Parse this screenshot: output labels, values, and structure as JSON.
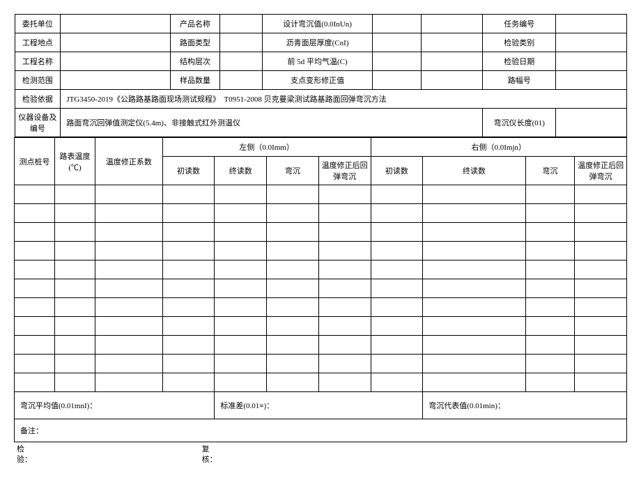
{
  "header": {
    "r1": {
      "c1_lbl": "委托单位",
      "c1_val": "",
      "c2_lbl": "产品名称",
      "c2_val": "",
      "c3_lbl": "设计弯沉值(0.0InUn)",
      "c3_val": "",
      "c4_lbl": "任务编号",
      "c4_val": ""
    },
    "r2": {
      "c1_lbl": "工程地点",
      "c1_val": "",
      "c2_lbl": "路面类型",
      "c2_val": "",
      "c3_lbl": "沥青面层厚度(CnI)",
      "c3_val": "",
      "c4_lbl": "检验类别",
      "c4_val": ""
    },
    "r3": {
      "c1_lbl": "工程名称",
      "c1_val": "",
      "c2_lbl": "结构层次",
      "c2_val": "",
      "c3_lbl": "前 5d 平均气温(C)",
      "c3_val": "",
      "c4_lbl": "检验日期",
      "c4_val": ""
    },
    "r4": {
      "c1_lbl": "检测范围",
      "c1_val": "",
      "c2_lbl": "样品数量",
      "c2_val": "",
      "c3_lbl": "支点变形修正值",
      "c3_val": "",
      "c4_lbl": "路幅号",
      "c4_val": ""
    },
    "r5": {
      "lbl": "检验依据",
      "val": "JTG3450-2019《公路路基路面现场测试规程》　T0951-2008 贝克曼梁测试路基路面回弹弯沉方法"
    },
    "r6": {
      "c1_lbl": "仪器设备及编号",
      "c1_val": "路面弯沉回弹值测定仪(5.4m)、非接触式红外测温仪",
      "c2_lbl": "弯沉仪长度(01)",
      "c2_val": ""
    }
  },
  "columns": {
    "c1": "测点桩号",
    "c2": "路表温度(℃)",
    "c3": "温度修正系数",
    "left_group": "左侧（0.0Imm）",
    "right_group": "右侧（0.0Imjn）",
    "sub1": "初读数",
    "sub2": "终读数",
    "sub3": "弯沉",
    "sub4": "温度修正后回弹弯沉"
  },
  "data_rows": [
    "",
    "",
    "",
    "",
    "",
    "",
    "",
    "",
    "",
    "",
    ""
  ],
  "summary": {
    "avg_lbl": "弯沉平均值(0.01mnI)：",
    "std_lbl": "标准差(0.01≡)：",
    "rep_lbl": "弯沉代表值(0.01min)："
  },
  "notes_lbl": "备注：",
  "footer": {
    "check": "检\n验：",
    "review": "复\n核："
  }
}
